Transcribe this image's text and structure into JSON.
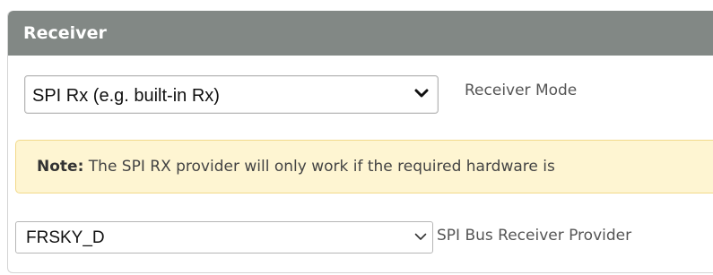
{
  "panel": {
    "title": "Receiver"
  },
  "receiver_mode": {
    "selected": "SPI Rx (e.g. built-in Rx)",
    "label": "Receiver Mode"
  },
  "note": {
    "prefix": "Note:",
    "text": " The SPI RX provider will only work if the required hardware is"
  },
  "spi_provider": {
    "selected": "FRSKY_D",
    "label": "SPI Bus Receiver Provider"
  },
  "icons": {
    "receiver_mode_arrow": "chevron-down-icon",
    "spi_provider_arrow": "chevron-down-icon"
  },
  "colors": {
    "header": "#828885",
    "note_background": "#fef5d2",
    "note_border": "#f2d98a"
  }
}
